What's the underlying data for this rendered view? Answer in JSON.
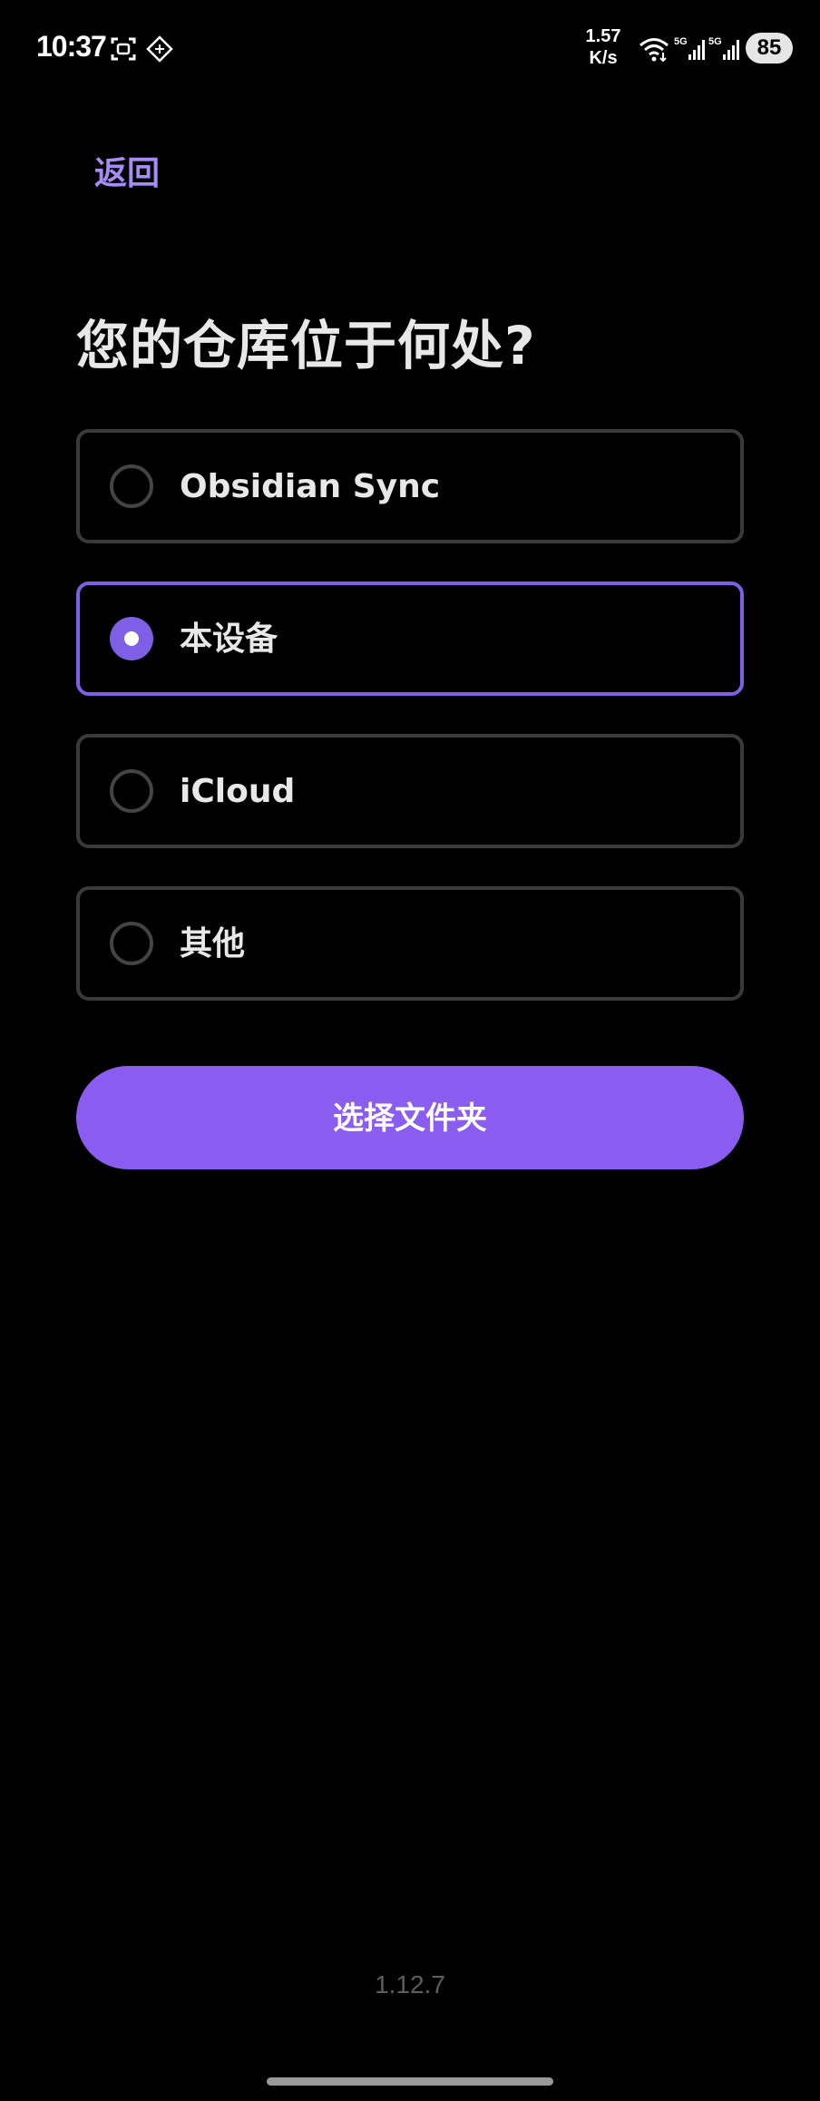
{
  "status_bar": {
    "time": "10:37",
    "net_speed_value": "1.57",
    "net_speed_unit": "K/s",
    "battery": "85",
    "icons": [
      "screenshot-icon",
      "app-notification-icon",
      "wifi-icon",
      "signal-5g-icon",
      "signal-5g-icon"
    ]
  },
  "nav": {
    "back_label": "返回"
  },
  "title": "您的仓库位于何处?",
  "options": [
    {
      "label": "Obsidian Sync",
      "selected": false
    },
    {
      "label": "本设备",
      "selected": true
    },
    {
      "label": "iCloud",
      "selected": false
    },
    {
      "label": "其他",
      "selected": false
    }
  ],
  "primary_button": {
    "label": "选择文件夹"
  },
  "version": "1.12.7",
  "colors": {
    "accent": "#8a5cf0",
    "accent_border": "#7f5fe6",
    "link": "#a88bf7",
    "background": "#000000",
    "option_border": "#3a3a3a"
  }
}
